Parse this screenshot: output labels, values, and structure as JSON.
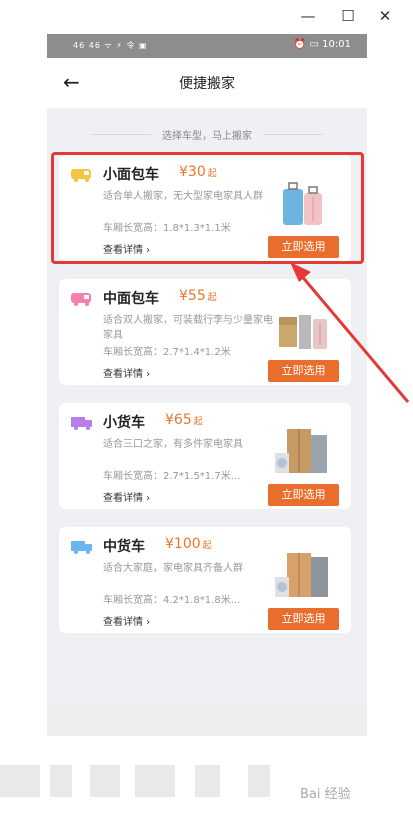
{
  "status_bar": {
    "left": "46 46 ᯤ ⚡ 令 ▣",
    "right": "⏰ ▭ 10:01"
  },
  "window_controls": {
    "minimize": "—",
    "maximize": "☐",
    "close": "✕"
  },
  "header": {
    "title": "便捷搬家"
  },
  "divider": "选择车型，马上搬家",
  "vehicles": [
    {
      "name": "小面包车",
      "price": "¥30",
      "suffix": "起",
      "desc": "适合单人搬家，无大型家电家具人群",
      "size": "车厢长宽高：1.8*1.3*1.1米",
      "detail": "查看详情",
      "button": "立即选用",
      "icon_color": "#f4c542"
    },
    {
      "name": "中面包车",
      "price": "¥55",
      "suffix": "起",
      "desc": "适合双人搬家，可装载行李与少量家电家具",
      "size": "车厢长宽高：2.7*1.4*1.2米",
      "detail": "查看详情",
      "button": "立即选用",
      "icon_color": "#f77fb0"
    },
    {
      "name": "小货车",
      "price": "¥65",
      "suffix": "起",
      "desc": "适合三口之家，有多件家电家具",
      "size": "车厢长宽高：2.7*1.5*1.7米...",
      "detail": "查看详情",
      "button": "立即选用",
      "icon_color": "#b67ee8"
    },
    {
      "name": "中货车",
      "price": "¥100",
      "suffix": "起",
      "desc": "适合大家庭，家电家具齐备人群",
      "size": "车厢长宽高：4.2*1.8*1.8米...",
      "detail": "查看详情",
      "button": "立即选用",
      "icon_color": "#6cb6f0"
    }
  ],
  "watermark": "Bai 经验"
}
